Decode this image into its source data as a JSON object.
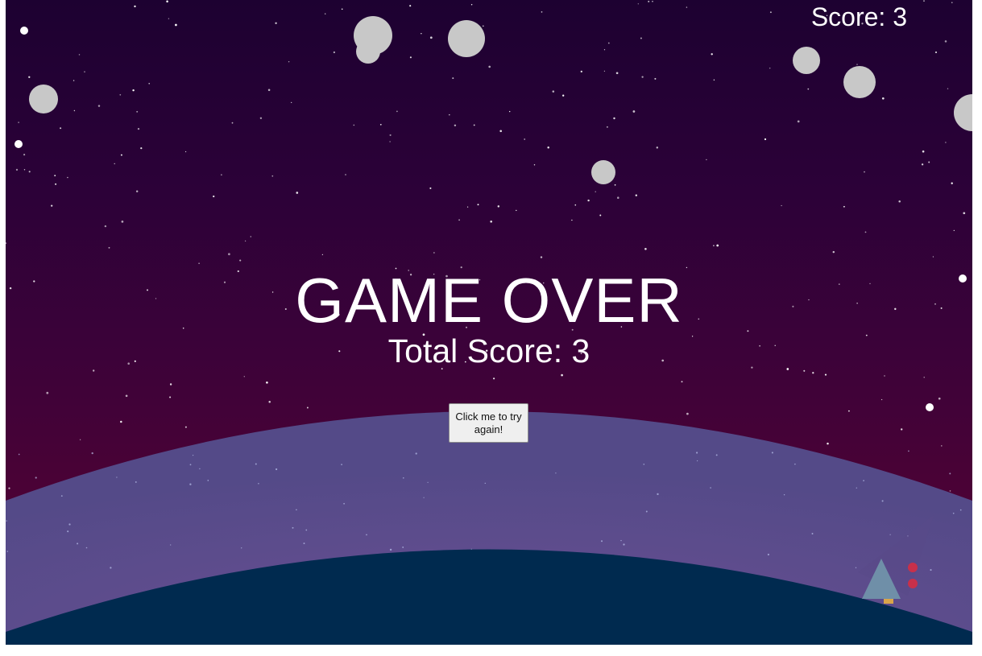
{
  "hud": {
    "score_label": "Score: 3"
  },
  "game_over": {
    "title": "GAME OVER",
    "total_score_label": "Total Score: 3",
    "retry_button_label": "Click me to try again!"
  },
  "palette": {
    "sky_top": "#1d0131",
    "sky_bottom": "#550333",
    "atmosphere": "#5e4c8c",
    "planet": "#002a4f",
    "asteroid": "#c8c8c8",
    "star": "#ffffff",
    "ship": "#6f8fa8",
    "ship_thrust": "#c8304a",
    "ship_flame": "#d8a54a"
  },
  "icons": {
    "asteroid": "asteroid-icon",
    "star": "star-icon",
    "ship": "spaceship-icon",
    "planet": "planet-icon"
  }
}
